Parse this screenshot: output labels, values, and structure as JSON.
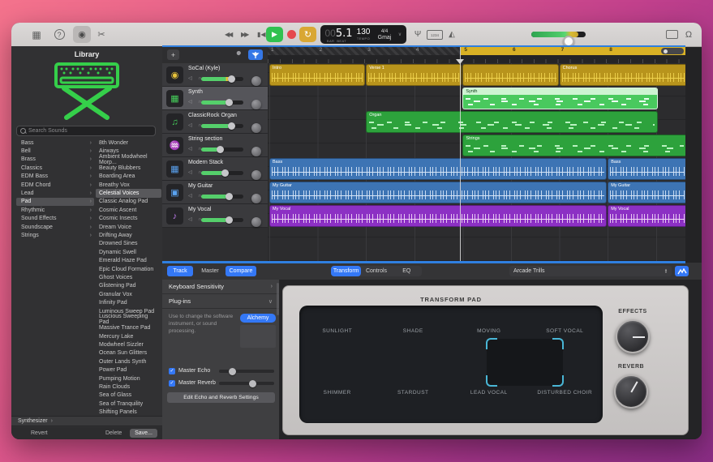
{
  "icons": {
    "keyboard": "▦",
    "help": "?",
    "smart_controls": "◉",
    "cut": "✂",
    "rewind": "◀◀",
    "forward": "▶▶",
    "to_start": "▮◀",
    "play": "▶",
    "cycle": "↻",
    "tuning_fork": "Ψ",
    "count_in": "1234",
    "metronome": "◭",
    "loop_browser": "Ω",
    "add_track": "+",
    "chevron_right": "›",
    "chevron_down": "∨",
    "check": "✓"
  },
  "colors": {
    "accent_blue": "#3478f6",
    "play_green": "#30c14f",
    "record_red": "#e5484d",
    "cycle_yellow": "#d9a733",
    "region_yellow": "#b8941c",
    "region_green": "#2da23c",
    "region_green_selected": "#49c95e",
    "region_blue": "#3d74b4",
    "region_purple": "#8c30c4"
  },
  "toolbar": {
    "lcd": {
      "bar_dim": "00",
      "position": "5.1",
      "bar_label": "BAR",
      "beat_label": "BEAT",
      "tempo": "130",
      "tempo_label": "TEMPO",
      "time_sig": "4/4",
      "key": "Gmaj"
    }
  },
  "library": {
    "title": "Library",
    "search_placeholder": "Search Sounds",
    "categories": [
      {
        "label": "Bass"
      },
      {
        "label": "Bell"
      },
      {
        "label": "Brass"
      },
      {
        "label": "Classics"
      },
      {
        "label": "EDM Bass"
      },
      {
        "label": "EDM Chord"
      },
      {
        "label": "Lead"
      },
      {
        "label": "Pad",
        "selected": true
      },
      {
        "label": "Rhythmic"
      },
      {
        "label": "Sound Effects"
      },
      {
        "label": "Soundscape"
      },
      {
        "label": "Strings"
      }
    ],
    "sounds": [
      {
        "label": "8th Wonder"
      },
      {
        "label": "Airways"
      },
      {
        "label": "Ambient Modwheel Morp..."
      },
      {
        "label": "Beauty Blubbers"
      },
      {
        "label": "Boarding Area"
      },
      {
        "label": "Breathy Vox"
      },
      {
        "label": "Celestial Voices",
        "selected": true
      },
      {
        "label": "Classic Analog Pad"
      },
      {
        "label": "Cosmic Ascent"
      },
      {
        "label": "Cosmic Insects"
      },
      {
        "label": "Dream Voice"
      },
      {
        "label": "Drifting Away"
      },
      {
        "label": "Drowned Sines"
      },
      {
        "label": "Dynamic Swell"
      },
      {
        "label": "Emerald Haze Pad"
      },
      {
        "label": "Epic Cloud Formation"
      },
      {
        "label": "Ghost Voices"
      },
      {
        "label": "Glistening Pad"
      },
      {
        "label": "Granular Vox"
      },
      {
        "label": "Infinity Pad"
      },
      {
        "label": "Luminous Sweep Pad"
      },
      {
        "label": "Luscious Sweeping Pad"
      },
      {
        "label": "Massive Trance Pad"
      },
      {
        "label": "Mercury Lake"
      },
      {
        "label": "Modwheel Sizzler"
      },
      {
        "label": "Ocean Sun Glitters"
      },
      {
        "label": "Outer Lands Synth"
      },
      {
        "label": "Power Pad"
      },
      {
        "label": "Pumping Motion"
      },
      {
        "label": "Rain Clouds"
      },
      {
        "label": "Sea of Glass"
      },
      {
        "label": "Sea of Tranquility"
      },
      {
        "label": "Shifting Panels"
      }
    ],
    "instrument": "Synthesizer",
    "revert": "Revert",
    "delete": "Delete",
    "save": "Save..."
  },
  "tracks": [
    {
      "name": "SoCal (Kyle)",
      "icon": "drums",
      "color": "#e8c33a",
      "volume": 72,
      "peak": true
    },
    {
      "name": "Synth",
      "icon": "keyboard",
      "color": "#46d05b",
      "volume": 66,
      "selected": true
    },
    {
      "name": "ClassicRock Organ",
      "icon": "organ",
      "color": "#46d05b",
      "volume": 72
    },
    {
      "name": "String section",
      "icon": "strings",
      "color": "#46d05b",
      "volume": 45
    },
    {
      "name": "Modern Stack",
      "icon": "keyboard",
      "color": "#5aa2f0",
      "volume": 55
    },
    {
      "name": "My Guitar",
      "icon": "amp",
      "color": "#5aa2f0",
      "volume": 65
    },
    {
      "name": "My Vocal",
      "icon": "mic",
      "color": "#c07cf0",
      "volume": 66
    }
  ],
  "timeline": {
    "bars": [
      1,
      2,
      3,
      4,
      5,
      6,
      7,
      8
    ],
    "cycle": {
      "start": 5,
      "end": 9.65
    },
    "playhead_bar": 5,
    "regions": [
      {
        "track": 0,
        "start": 1,
        "end": 3,
        "label": "Intro",
        "kind": "audio",
        "color": "yellow"
      },
      {
        "track": 0,
        "start": 3,
        "end": 5,
        "label": "Verse 1",
        "kind": "audio",
        "color": "yellow"
      },
      {
        "track": 0,
        "start": 5,
        "end": 7,
        "label": "",
        "kind": "audio",
        "color": "yellow"
      },
      {
        "track": 0,
        "start": 7,
        "end": 9.65,
        "label": "Chorus",
        "kind": "audio",
        "color": "yellow"
      },
      {
        "track": 1,
        "start": 5,
        "end": 9.05,
        "label": "Synth",
        "kind": "midi",
        "color": "green",
        "selected": true
      },
      {
        "track": 2,
        "start": 3,
        "end": 9.05,
        "label": "Organ",
        "kind": "midi",
        "color": "green"
      },
      {
        "track": 3,
        "start": 5,
        "end": 9.65,
        "label": "Strings",
        "kind": "midi",
        "color": "green"
      },
      {
        "track": 4,
        "start": 1,
        "end": 8,
        "label": "Bass",
        "kind": "audio",
        "color": "blue"
      },
      {
        "track": 4,
        "start": 8,
        "end": 9.65,
        "label": "Bass",
        "kind": "audio",
        "color": "blue"
      },
      {
        "track": 5,
        "start": 1,
        "end": 8,
        "label": "My Guitar",
        "kind": "audio",
        "color": "blue"
      },
      {
        "track": 5,
        "start": 8,
        "end": 9.65,
        "label": "My Guitar",
        "kind": "audio",
        "color": "blue"
      },
      {
        "track": 6,
        "start": 1,
        "end": 8,
        "label": "My Vocal",
        "kind": "audio",
        "color": "purple"
      },
      {
        "track": 6,
        "start": 8,
        "end": 9.65,
        "label": "My Vocal",
        "kind": "audio",
        "color": "purple"
      }
    ]
  },
  "inspector": {
    "track_tab": "Track",
    "master_tab": "Master",
    "compare_tab": "Compare",
    "segments": [
      {
        "label": "Transform",
        "selected": true
      },
      {
        "label": "Controls"
      },
      {
        "label": "EQ"
      }
    ],
    "preset": "Arcade Trills",
    "keyboard_sensitivity": "Keyboard Sensitivity",
    "plugins": "Plug-ins",
    "plugins_desc": "Use to change the software instrument, or sound processing.",
    "alchemy": "Alchemy",
    "master_echo": "Master Echo",
    "master_reverb": "Master Reverb",
    "edit_button": "Edit Echo and Reverb Settings"
  },
  "smart_controls": {
    "title": "TRANSFORM PAD",
    "pads": [
      "SUNLIGHT",
      "SHADE",
      "MOVING",
      "SOFT VOCAL",
      "SHIMMER",
      "STARDUST",
      "LEAD VOCAL",
      "DISTURBED CHOIR"
    ],
    "knobs": [
      {
        "label": "EFFECTS"
      },
      {
        "label": "REVERB"
      }
    ]
  }
}
